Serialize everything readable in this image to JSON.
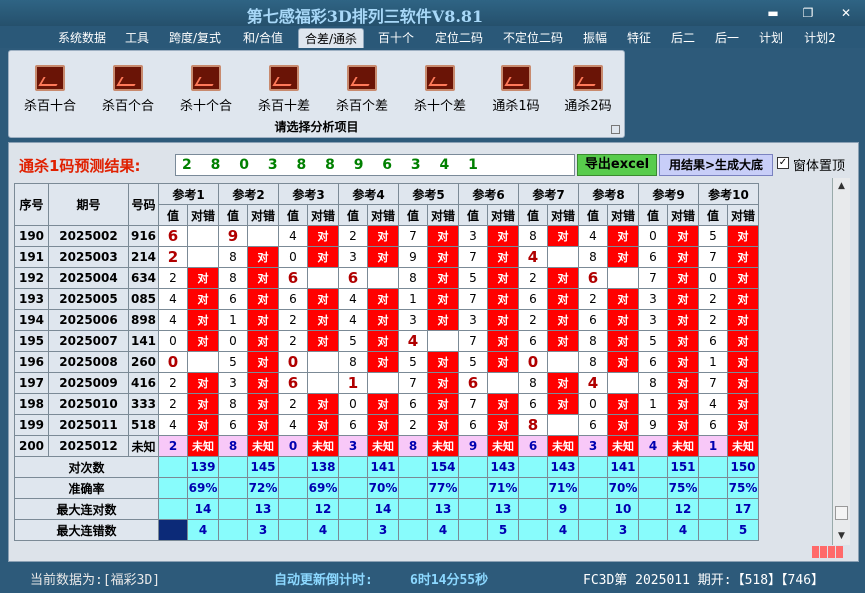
{
  "window": {
    "title": "第七感福彩3D排列三软件V8.81",
    "minimize_glyph": "▬",
    "restore_glyph": "❐",
    "close_glyph": "✕"
  },
  "menu": [
    "系统数据",
    "工具",
    "跨度/复式",
    "和/合值",
    "合差/通杀",
    "百十个",
    "定位二码",
    "不定位二码",
    "振幅",
    "特征",
    "后二",
    "后一",
    "计划",
    "计划2"
  ],
  "active_menu": "合差/通杀",
  "ribbon": {
    "buttons": [
      "杀百十合",
      "杀百个合",
      "杀十个合",
      "杀百十差",
      "杀百个差",
      "杀十个差",
      "通杀1码",
      "通杀2码"
    ],
    "caption": "请选择分析项目",
    "icon": "chart-icon"
  },
  "prediction": {
    "label": "通杀1码预测结果:",
    "value": "2 8 0 3 8 8 9 6 3 4 1"
  },
  "buttons": {
    "excel": "导出excel",
    "generate": "用结果>生成大底"
  },
  "checkbox": {
    "label": "窗体置顶",
    "checked": true,
    "glyph": "✓"
  },
  "table": {
    "headers": {
      "seq": "序号",
      "period": "期号",
      "code": "号码",
      "refs": [
        "参考1",
        "参考2",
        "参考3",
        "参考4",
        "参考5",
        "参考6",
        "参考7",
        "参考8",
        "参考9",
        "参考10"
      ],
      "val": "值",
      "res": "对错"
    },
    "rows": [
      {
        "seq": "190",
        "period": "2025002",
        "code": "916",
        "v": [
          "6",
          "9",
          "4",
          "2",
          "7",
          "3",
          "8",
          "4",
          "0",
          "5"
        ],
        "r": [
          "",
          "",
          "对",
          "对",
          "对",
          "对",
          "对",
          "对",
          "对",
          "对"
        ]
      },
      {
        "seq": "191",
        "period": "2025003",
        "code": "214",
        "v": [
          "2",
          "8",
          "0",
          "3",
          "9",
          "7",
          "4",
          "8",
          "6",
          "7"
        ],
        "r": [
          "",
          "对",
          "对",
          "对",
          "对",
          "对",
          "",
          "对",
          "对",
          "对"
        ]
      },
      {
        "seq": "192",
        "period": "2025004",
        "code": "634",
        "v": [
          "2",
          "8",
          "6",
          "6",
          "8",
          "5",
          "2",
          "6",
          "7",
          "0"
        ],
        "r": [
          "对",
          "对",
          "",
          "",
          "对",
          "对",
          "对",
          "",
          "对",
          "对"
        ]
      },
      {
        "seq": "193",
        "period": "2025005",
        "code": "085",
        "v": [
          "4",
          "6",
          "6",
          "4",
          "1",
          "7",
          "6",
          "2",
          "3",
          "2"
        ],
        "r": [
          "对",
          "对",
          "对",
          "对",
          "对",
          "对",
          "对",
          "对",
          "对",
          "对"
        ]
      },
      {
        "seq": "194",
        "period": "2025006",
        "code": "898",
        "v": [
          "4",
          "1",
          "2",
          "4",
          "3",
          "3",
          "2",
          "6",
          "3",
          "2"
        ],
        "r": [
          "对",
          "对",
          "对",
          "对",
          "对",
          "对",
          "对",
          "对",
          "对",
          "对"
        ]
      },
      {
        "seq": "195",
        "period": "2025007",
        "code": "141",
        "v": [
          "0",
          "0",
          "2",
          "5",
          "4",
          "7",
          "6",
          "8",
          "5",
          "6"
        ],
        "r": [
          "对",
          "对",
          "对",
          "对",
          "",
          "对",
          "对",
          "对",
          "对",
          "对"
        ]
      },
      {
        "seq": "196",
        "period": "2025008",
        "code": "260",
        "v": [
          "0",
          "5",
          "0",
          "8",
          "5",
          "5",
          "0",
          "8",
          "6",
          "1"
        ],
        "r": [
          "",
          "对",
          "",
          "对",
          "对",
          "对",
          "",
          "对",
          "对",
          "对"
        ]
      },
      {
        "seq": "197",
        "period": "2025009",
        "code": "416",
        "v": [
          "2",
          "3",
          "6",
          "1",
          "7",
          "6",
          "8",
          "4",
          "8",
          "7"
        ],
        "r": [
          "对",
          "对",
          "",
          "",
          "对",
          "",
          "对",
          "",
          "对",
          "对"
        ]
      },
      {
        "seq": "198",
        "period": "2025010",
        "code": "333",
        "v": [
          "2",
          "8",
          "2",
          "0",
          "6",
          "7",
          "6",
          "0",
          "1",
          "4"
        ],
        "r": [
          "对",
          "对",
          "对",
          "对",
          "对",
          "对",
          "对",
          "对",
          "对",
          "对"
        ]
      },
      {
        "seq": "199",
        "period": "2025011",
        "code": "518",
        "v": [
          "4",
          "6",
          "4",
          "6",
          "2",
          "6",
          "8",
          "6",
          "9",
          "6"
        ],
        "r": [
          "对",
          "对",
          "对",
          "对",
          "对",
          "对",
          "",
          "对",
          "对",
          "对"
        ]
      },
      {
        "seq": "200",
        "period": "2025012",
        "code": "未知",
        "v": [
          "2",
          "8",
          "0",
          "3",
          "8",
          "9",
          "6",
          "3",
          "4",
          "1"
        ],
        "r": [
          "未知",
          "未知",
          "未知",
          "未知",
          "未知",
          "未知",
          "未知",
          "未知",
          "未知",
          "未知"
        ]
      }
    ],
    "stats": [
      {
        "label": "对次数",
        "values": [
          "139",
          "145",
          "138",
          "141",
          "154",
          "143",
          "143",
          "141",
          "151",
          "150"
        ]
      },
      {
        "label": "准确率",
        "values": [
          "69%",
          "72%",
          "69%",
          "70%",
          "77%",
          "71%",
          "71%",
          "70%",
          "75%",
          "75%"
        ]
      },
      {
        "label": "最大连对数",
        "values": [
          "14",
          "13",
          "12",
          "14",
          "13",
          "13",
          "9",
          "10",
          "12",
          "17"
        ]
      },
      {
        "label": "最大连错数",
        "values": [
          "4",
          "3",
          "4",
          "3",
          "4",
          "5",
          "4",
          "3",
          "4",
          "5"
        ]
      }
    ]
  },
  "statusbar": {
    "current": "当前数据为:[福彩3D]",
    "countdown_label": "自动更新倒计时:",
    "countdown_value": "6时14分55秒",
    "info": "FC3D第 2025011 期开:【518】【746】"
  },
  "scroll": {
    "up": "▲",
    "down": "▼"
  },
  "colors": {
    "error": "#ff0000",
    "highlight": "#b00000",
    "unknown_bg": "#f8c8f8",
    "stats_bg": "#88fcfc",
    "accent_blue": "#0000b0",
    "title": "#a8d8f8",
    "red_label": "#e02000"
  }
}
